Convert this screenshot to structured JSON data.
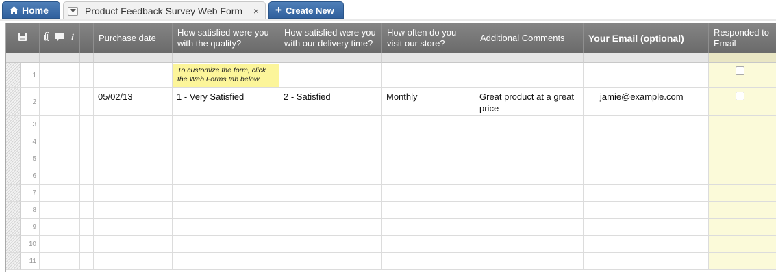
{
  "tabs": {
    "home_label": "Home",
    "sheet_label": "Product Feedback Survey Web Form",
    "close_glyph": "×",
    "create_label": "Create New"
  },
  "grid": {
    "columns": [
      {
        "key": "purchase_date",
        "label": "Purchase date",
        "bold": false
      },
      {
        "key": "quality",
        "label": "How satisfied were you with the quality?",
        "bold": false
      },
      {
        "key": "delivery",
        "label": "How satisfied were you with our delivery time?",
        "bold": false
      },
      {
        "key": "visit",
        "label": "How often do you visit our store?",
        "bold": false
      },
      {
        "key": "comments",
        "label": "Additional Comments",
        "bold": false
      },
      {
        "key": "email",
        "label": "Your Email (optional)",
        "bold": true
      },
      {
        "key": "responded",
        "label": "Responded to Email",
        "bold": false
      }
    ],
    "icons": [
      "save-icon",
      "attachment-icon",
      "comment-icon",
      "info-icon"
    ],
    "hint_text": "To customize the form, click the Web Forms tab below",
    "rows": [
      {
        "num": "1",
        "purchase_date": "",
        "quality": "",
        "delivery": "",
        "visit": "",
        "comments": "",
        "email": "",
        "responded": false,
        "hint": true
      },
      {
        "num": "2",
        "purchase_date": "05/02/13",
        "quality": "1 - Very Satisfied",
        "delivery": "2 - Satisfied",
        "visit": "Monthly",
        "comments": "Great product at a great price",
        "email": "jamie@example.com",
        "responded": false,
        "hint": false
      },
      {
        "num": "3"
      },
      {
        "num": "4"
      },
      {
        "num": "5"
      },
      {
        "num": "6"
      },
      {
        "num": "7"
      },
      {
        "num": "8"
      },
      {
        "num": "9"
      },
      {
        "num": "10"
      },
      {
        "num": "11"
      }
    ]
  },
  "colors": {
    "tab_blue": "#3a6aa8",
    "header_gray": "#777777",
    "responded_column_tint": "#fbfad9",
    "hint_yellow": "#fcf59a"
  }
}
